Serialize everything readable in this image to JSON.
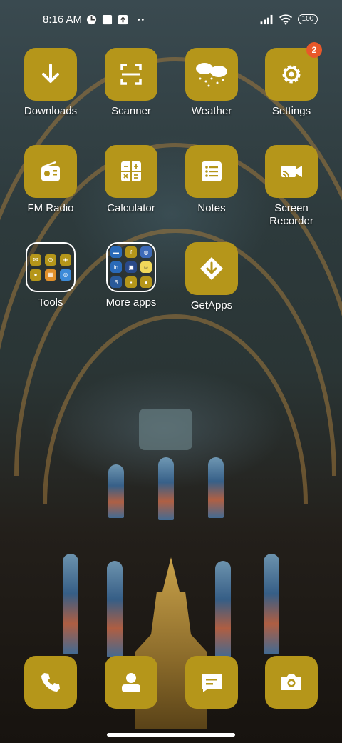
{
  "status_bar": {
    "time": "8:16 AM",
    "battery": "100"
  },
  "apps": [
    {
      "label": "Downloads",
      "icon": "download-icon"
    },
    {
      "label": "Scanner",
      "icon": "scanner-icon"
    },
    {
      "label": "Weather",
      "icon": "weather-icon"
    },
    {
      "label": "Settings",
      "icon": "gear-icon",
      "badge": "2"
    },
    {
      "label": "FM Radio",
      "icon": "radio-icon"
    },
    {
      "label": "Calculator",
      "icon": "calculator-icon"
    },
    {
      "label": "Notes",
      "icon": "notes-icon"
    },
    {
      "label": "Screen\nRecorder",
      "icon": "screen-recorder-icon"
    },
    {
      "label": "Tools",
      "icon": "folder-icon"
    },
    {
      "label": "More apps",
      "icon": "folder-icon"
    },
    {
      "label": "GetApps",
      "icon": "getapps-icon"
    }
  ],
  "dock": [
    {
      "icon": "phone-icon"
    },
    {
      "icon": "contacts-icon"
    },
    {
      "icon": "messages-icon"
    },
    {
      "icon": "camera-icon"
    }
  ],
  "colors": {
    "tile": "#b5961a",
    "badge": "#e8582a"
  }
}
